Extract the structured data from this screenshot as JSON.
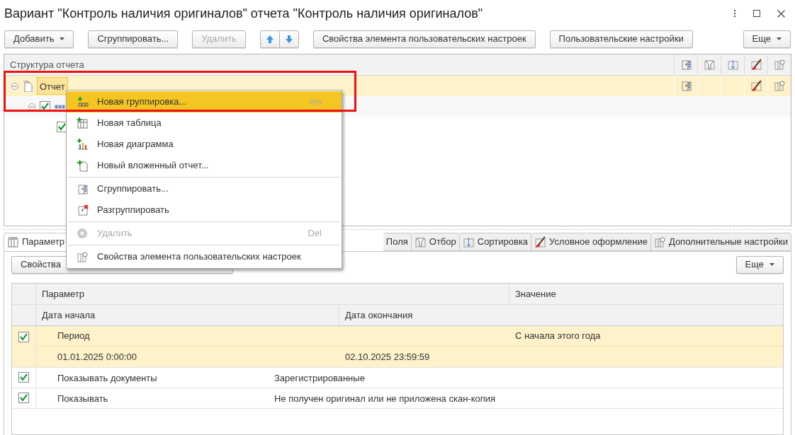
{
  "window": {
    "title": "Вариант \"Контроль наличия оригиналов\" отчета \"Контроль наличия оригиналов\""
  },
  "toolbar": [
    {
      "kind": "button",
      "label": "Добавить",
      "dropdown": true,
      "disabled": false
    },
    {
      "kind": "button",
      "label": "Сгруппировать...",
      "dropdown": false,
      "disabled": false
    },
    {
      "kind": "button",
      "label": "Удалить",
      "dropdown": false,
      "disabled": true
    },
    {
      "kind": "arrows"
    },
    {
      "kind": "button",
      "label": "Свойства элемента пользовательских настроек",
      "dropdown": false,
      "disabled": false
    },
    {
      "kind": "button",
      "label": "Пользовательские настройки",
      "dropdown": false,
      "disabled": false
    },
    {
      "kind": "more",
      "label": "Еще",
      "dropdown": true,
      "disabled": false
    }
  ],
  "structure": {
    "title": "Структура отчета",
    "rows": [
      {
        "label": "Отчет",
        "selected": true,
        "expanded": true,
        "children": [
          {
            "checked": true,
            "expanded": true,
            "children": [
              {
                "checked": true
              }
            ]
          }
        ]
      }
    ]
  },
  "context_menu": [
    {
      "kind": "item",
      "label": "Новая группировка...",
      "shortcut": "Ins",
      "selected": true,
      "disabled": false
    },
    {
      "kind": "item",
      "label": "Новая таблица",
      "selected": false,
      "disabled": false
    },
    {
      "kind": "item",
      "label": "Новая диаграмма",
      "selected": false,
      "disabled": false
    },
    {
      "kind": "item",
      "label": "Новый вложенный отчет...",
      "selected": false,
      "disabled": false
    },
    {
      "kind": "separator"
    },
    {
      "kind": "item",
      "label": "Сгруппировать...",
      "selected": false,
      "disabled": false
    },
    {
      "kind": "item",
      "label": "Разгруппировать",
      "selected": false,
      "disabled": false
    },
    {
      "kind": "separator"
    },
    {
      "kind": "item",
      "label": "Удалить",
      "shortcut": "Del",
      "selected": false,
      "disabled": true
    },
    {
      "kind": "separator"
    },
    {
      "kind": "item",
      "label": "Свойства элемента пользовательских настроек",
      "selected": false,
      "disabled": false
    }
  ],
  "tabs": [
    {
      "label": "Параметр",
      "selected": true
    },
    {
      "label": "Поля",
      "selected": false
    },
    {
      "label": "Отбор",
      "selected": false
    },
    {
      "label": "Сортировка",
      "selected": false
    },
    {
      "label": "Условное оформление",
      "selected": false
    },
    {
      "label": "Дополнительные настройки",
      "selected": false
    }
  ],
  "panel_toolbar": {
    "button": "Свойства",
    "more": "Еще"
  },
  "parameters": {
    "columns": [
      "Параметр",
      "Значение"
    ],
    "subcolumns": [
      "Дата начала",
      "Дата окончания"
    ],
    "rows": [
      {
        "kind": "period",
        "checked": true,
        "selected": true,
        "name": "Период",
        "value": "С начала этого года",
        "start": "01.01.2025 0:00:00",
        "end": "02.10.2025 23:59:59"
      },
      {
        "kind": "simple",
        "checked": true,
        "selected": false,
        "name": "Показывать документы",
        "value": "Зарегистрированные"
      },
      {
        "kind": "simple",
        "checked": true,
        "selected": false,
        "name": "Показывать",
        "value": "Не получен оригинал или не приложена скан-копия"
      }
    ]
  }
}
